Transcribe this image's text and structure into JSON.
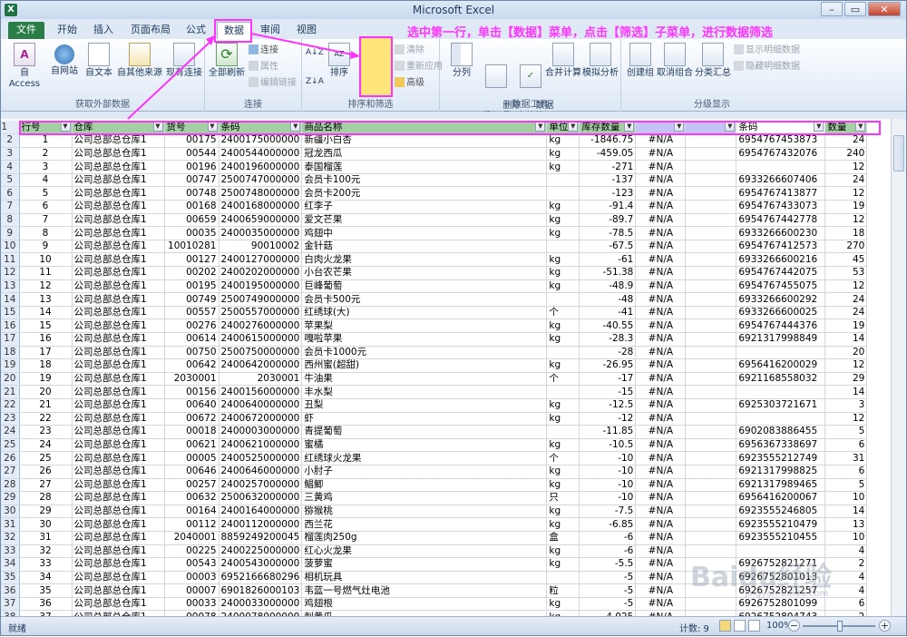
{
  "app": {
    "title": "Microsoft Excel",
    "icon": "excel-icon"
  },
  "annotation": "选中第一行，单击【数据】菜单，点击【筛选】子菜单，进行数据筛选",
  "tabs": [
    {
      "label": "文件"
    },
    {
      "label": "开始"
    },
    {
      "label": "插入"
    },
    {
      "label": "页面布局"
    },
    {
      "label": "公式"
    },
    {
      "label": "数据"
    },
    {
      "label": "审阅"
    },
    {
      "label": "视图"
    }
  ],
  "ribbon": {
    "ext_data": {
      "label": "获取外部数据",
      "btns": [
        "自 Access",
        "自网站",
        "自文本",
        "自其他来源",
        "现有连接"
      ]
    },
    "connections": {
      "label": "连接",
      "refresh": "全部刷新",
      "small": [
        "连接",
        "属性",
        "编辑链接"
      ]
    },
    "sort_filter": {
      "label": "排序和筛选",
      "sort": "排序",
      "filter": "筛选",
      "small": [
        "清除",
        "重新应用",
        "高级"
      ]
    },
    "data_tools": {
      "label": "数据工具",
      "btns": [
        "分列",
        "删除\n重复项",
        "数据\n有效性",
        "合并计算",
        "模拟分析"
      ]
    },
    "outline": {
      "label": "分级显示",
      "btns": [
        "创建组",
        "取消组合",
        "分类汇总"
      ],
      "small": [
        "显示明细数据",
        "隐藏明细数据"
      ]
    }
  },
  "sheet": {
    "headers": [
      "行号",
      "仓库",
      "货号",
      "条码",
      "商品名称",
      "单位",
      "库存数量",
      "",
      "",
      "条码",
      "数量"
    ],
    "rows": [
      [
        "1",
        "公司总部总仓库1",
        "00175",
        "2400175000000",
        "新疆小白杏",
        "kg",
        "-1846.75",
        "#N/A",
        "",
        "6954767453873",
        "24"
      ],
      [
        "2",
        "公司总部总仓库1",
        "00544",
        "2400544000000",
        "冠龙西瓜",
        "kg",
        "-459.05",
        "#N/A",
        "",
        "6954767432076",
        "240"
      ],
      [
        "3",
        "公司总部总仓库1",
        "00196",
        "2400196000000",
        "泰国榴莲",
        "kg",
        "-271",
        "#N/A",
        "",
        "",
        "12"
      ],
      [
        "4",
        "公司总部总仓库1",
        "00747",
        "2500747000000",
        "会员卡100元",
        "",
        "-137",
        "#N/A",
        "",
        "6933266607406",
        "24"
      ],
      [
        "5",
        "公司总部总仓库1",
        "00748",
        "2500748000000",
        "会员卡200元",
        "",
        "-123",
        "#N/A",
        "",
        "6954767413877",
        "12"
      ],
      [
        "6",
        "公司总部总仓库1",
        "00168",
        "2400168000000",
        "红李子",
        "kg",
        "-91.4",
        "#N/A",
        "",
        "6954767433073",
        "19"
      ],
      [
        "7",
        "公司总部总仓库1",
        "00659",
        "2400659000000",
        "爱文芒果",
        "kg",
        "-89.7",
        "#N/A",
        "",
        "6954767442778",
        "12"
      ],
      [
        "8",
        "公司总部总仓库1",
        "00035",
        "2400035000000",
        "鸡翅中",
        "kg",
        "-78.5",
        "#N/A",
        "",
        "6933266600230",
        "18"
      ],
      [
        "9",
        "公司总部总仓库1",
        "10010281",
        "90010002",
        "金针菇",
        "",
        "-67.5",
        "#N/A",
        "",
        "6954767412573",
        "270"
      ],
      [
        "10",
        "公司总部总仓库1",
        "00127",
        "2400127000000",
        "白肉火龙果",
        "kg",
        "-61",
        "#N/A",
        "",
        "6933266600216",
        "45"
      ],
      [
        "11",
        "公司总部总仓库1",
        "00202",
        "2400202000000",
        "小台农芒果",
        "kg",
        "-51.38",
        "#N/A",
        "",
        "6954767442075",
        "53"
      ],
      [
        "12",
        "公司总部总仓库1",
        "00195",
        "2400195000000",
        "巨峰葡萄",
        "kg",
        "-48.9",
        "#N/A",
        "",
        "6954767455075",
        "12"
      ],
      [
        "13",
        "公司总部总仓库1",
        "00749",
        "2500749000000",
        "会员卡500元",
        "",
        "-48",
        "#N/A",
        "",
        "6933266600292",
        "24"
      ],
      [
        "14",
        "公司总部总仓库1",
        "00557",
        "2500557000000",
        "红绣球(大)",
        "个",
        "-41",
        "#N/A",
        "",
        "6933266600025",
        "24"
      ],
      [
        "15",
        "公司总部总仓库1",
        "00276",
        "2400276000000",
        "苹果梨",
        "kg",
        "-40.55",
        "#N/A",
        "",
        "6954767444376",
        "19"
      ],
      [
        "16",
        "公司总部总仓库1",
        "00614",
        "2400615000000",
        "嘎啦苹果",
        "kg",
        "-28.3",
        "#N/A",
        "",
        "6921317998849",
        "14"
      ],
      [
        "17",
        "公司总部总仓库1",
        "00750",
        "2500750000000",
        "会员卡1000元",
        "",
        "-28",
        "#N/A",
        "",
        "",
        "20"
      ],
      [
        "18",
        "公司总部总仓库1",
        "00642",
        "2400642000000",
        "西州蜜(超甜)",
        "kg",
        "-26.95",
        "#N/A",
        "",
        "6956416200029",
        "12"
      ],
      [
        "19",
        "公司总部总仓库1",
        "2030001",
        "2030001",
        "牛油果",
        "个",
        "-17",
        "#N/A",
        "",
        "6921168558032",
        "29"
      ],
      [
        "20",
        "公司总部总仓库1",
        "00156",
        "2400156000000",
        "丰水梨",
        "",
        "-15",
        "#N/A",
        "",
        "",
        "14"
      ],
      [
        "21",
        "公司总部总仓库1",
        "00640",
        "2400640000000",
        "丑梨",
        "kg",
        "-12.5",
        "#N/A",
        "",
        "6925303721671",
        "3"
      ],
      [
        "22",
        "公司总部总仓库1",
        "00672",
        "2400672000000",
        "虾",
        "kg",
        "-12",
        "#N/A",
        "",
        "",
        "12"
      ],
      [
        "23",
        "公司总部总仓库1",
        "00018",
        "2400003000000",
        "青提葡萄",
        "",
        "-11.85",
        "#N/A",
        "",
        "6902083886455",
        "5"
      ],
      [
        "24",
        "公司总部总仓库1",
        "00621",
        "2400621000000",
        "蜜橘",
        "kg",
        "-10.5",
        "#N/A",
        "",
        "6956367338697",
        "6"
      ],
      [
        "25",
        "公司总部总仓库1",
        "00005",
        "2400525000000",
        "红绣球火龙果",
        "个",
        "-10",
        "#N/A",
        "",
        "6923555212749",
        "31"
      ],
      [
        "26",
        "公司总部总仓库1",
        "00646",
        "2400646000000",
        "小肘子",
        "kg",
        "-10",
        "#N/A",
        "",
        "6921317998825",
        "6"
      ],
      [
        "27",
        "公司总部总仓库1",
        "00257",
        "2400257000000",
        "鲳鲫",
        "kg",
        "-10",
        "#N/A",
        "",
        "6921317989465",
        "5"
      ],
      [
        "28",
        "公司总部总仓库1",
        "00632",
        "2500632000000",
        "三黄鸡",
        "只",
        "-10",
        "#N/A",
        "",
        "6956416200067",
        "10"
      ],
      [
        "29",
        "公司总部总仓库1",
        "00164",
        "2400164000000",
        "猕猴桃",
        "kg",
        "-7.5",
        "#N/A",
        "",
        "6923555246805",
        "14"
      ],
      [
        "30",
        "公司总部总仓库1",
        "00112",
        "2400112000000",
        "西兰花",
        "kg",
        "-6.85",
        "#N/A",
        "",
        "6923555210479",
        "13"
      ],
      [
        "31",
        "公司总部总仓库1",
        "2040001",
        "8859249200045",
        "榴莲肉250g",
        "盒",
        "-6",
        "#N/A",
        "",
        "6923555210455",
        "10"
      ],
      [
        "32",
        "公司总部总仓库1",
        "00225",
        "2400225000000",
        "红心火龙果",
        "kg",
        "-6",
        "#N/A",
        "",
        "",
        "4"
      ],
      [
        "33",
        "公司总部总仓库1",
        "00543",
        "2400543000000",
        "菠萝蜜",
        "kg",
        "-5.5",
        "#N/A",
        "",
        "6926752821271",
        "2"
      ],
      [
        "34",
        "公司总部总仓库1",
        "00003",
        "6952166680296",
        "相机玩具",
        "",
        "-5",
        "#N/A",
        "",
        "6926752801013",
        "4"
      ],
      [
        "35",
        "公司总部总仓库1",
        "00007",
        "6901826000103",
        "韦蓝一号燃气灶电池",
        "粒",
        "-5",
        "#N/A",
        "",
        "6926752821257",
        "4"
      ],
      [
        "36",
        "公司总部总仓库1",
        "00033",
        "2400033000000",
        "鸡翅根",
        "kg",
        "-5",
        "#N/A",
        "",
        "6926752801099",
        "6"
      ],
      [
        "37",
        "公司总部总仓库1",
        "00078",
        "2400078000000",
        "刺黄瓜",
        "kg",
        "-4.025",
        "#N/A",
        "",
        "6926752804743",
        "2"
      ]
    ]
  },
  "status": {
    "ready": "就绪",
    "count": "计数: 9",
    "zoom": "100%"
  },
  "watermark": "Baidu经验",
  "watermark_sub": "jingyan.baidu.com"
}
